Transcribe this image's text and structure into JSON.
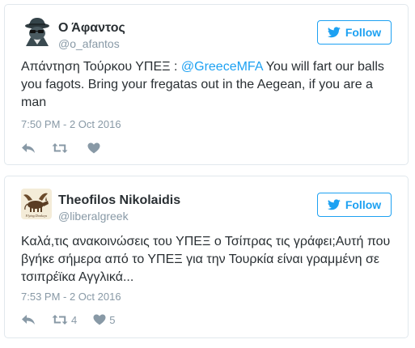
{
  "tweets": [
    {
      "display_name": "Ο Άφαντος",
      "handle": "@o_afantos",
      "follow_label": "Follow",
      "text_before": "Απάντηση Τούρκου ΥΠΕΞ : ",
      "mention": "@GreeceMFA",
      "text_after": " You will fart our balls you fagots. Bring your fregatas out in the Aegean, if you are a man",
      "timestamp": "7:50 PM - 2 Oct 2016",
      "retweet_count": "",
      "like_count": "",
      "avatar_icon": "spy-cat-avatar"
    },
    {
      "display_name": "Theofilos Nikolaidis",
      "handle": "@liberalgreek",
      "follow_label": "Follow",
      "text": "Καλά,τις ανακοινώσεις του ΥΠΕΞ ο Τσίπρας τις γράφει;Αυτή που βγήκε σήμερα από το ΥΠΕΞ για την Τουρκία είναι γραμμένη σε τσιπρέϊκα Αγγλικά...",
      "timestamp": "7:53 PM - 2 Oct 2016",
      "retweet_count": "4",
      "like_count": "5",
      "avatar_icon": "flying-donkey-avatar",
      "avatar_caption": "Flying Donkeys"
    }
  ],
  "colors": {
    "twitter_blue": "#1da1f2",
    "text": "#292f33",
    "muted": "#8899a6",
    "icon": "#aab8c2",
    "border": "#e1e8ed"
  },
  "icons": [
    "twitter-bird-icon",
    "reply-icon",
    "retweet-icon",
    "like-heart-icon"
  ]
}
